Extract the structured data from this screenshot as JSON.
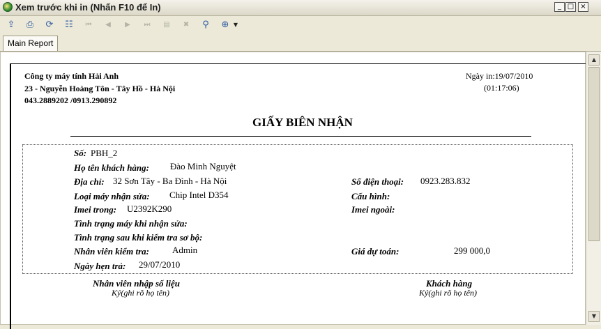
{
  "window": {
    "title": "Xem trước khi in (Nhấn F10 để In)",
    "buttons": {
      "minimize": "_",
      "maximize": "□",
      "close": "×"
    }
  },
  "toolbar": {
    "icons": [
      "export-icon",
      "print-icon",
      "refresh-icon",
      "group-tree-icon",
      "first-page-icon",
      "prev-page-icon",
      "next-page-icon",
      "last-page-icon",
      "goto-page-icon",
      "stop-icon",
      "search-icon",
      "zoom-icon"
    ]
  },
  "tabs": [
    {
      "label": "Main Report"
    }
  ],
  "company": {
    "name": "Công ty máy tính Hải Anh",
    "address": "23 - Nguyễn Hoàng Tôn - Tây Hồ - Hà Nội",
    "phones": "043.2889202 /0913.290892"
  },
  "report_date": {
    "label": "Ngày in:",
    "date": "19/07/2010",
    "time": "(01:17:06)"
  },
  "doc_title": "GIẤY BIÊN NHẬN",
  "fields": {
    "so": {
      "label": "Số:",
      "value": "PBH_2"
    },
    "ho_ten": {
      "label": "Họ tên khách hàng:",
      "value": "Đào Minh Nguyệt"
    },
    "dia_chi": {
      "label": "Địa chỉ:",
      "value": "32 Sơn Tây - Ba Đình - Hà Nội"
    },
    "so_dien_thoai": {
      "label": "Số điện thoại:",
      "value": "0923.283.832"
    },
    "loai_may": {
      "label": "Loại máy nhận sửa:",
      "value": "Chip Intel D354"
    },
    "cau_hinh": {
      "label": "Cấu hình:",
      "value": ""
    },
    "imei_trong": {
      "label": "Imei trong:",
      "value": "U2392K290"
    },
    "imei_ngoai": {
      "label": "Imei ngoài:",
      "value": ""
    },
    "tinh_trang_nhan": {
      "label": "Tình trạng máy khi nhận sửa:",
      "value": ""
    },
    "tinh_trang_kiem_tra": {
      "label": "Tình trạng sau khi kiểm tra sơ bộ:",
      "value": ""
    },
    "nhan_vien_kiem_tra": {
      "label": "Nhân viên kiểm tra:",
      "value": "Admin"
    },
    "gia_du_toan": {
      "label": "Giá dự toán:",
      "value": "299 000,0"
    },
    "ngay_hen_tra": {
      "label": "Ngày hẹn trả:",
      "value": "29/07/2010"
    }
  },
  "signatures": {
    "left": {
      "label": "Nhân viên nhập số liệu",
      "note": "Ký(ghi rõ họ tên)"
    },
    "right": {
      "label": "Khách hàng",
      "note": "Ký(ghi rõ họ tên)"
    }
  }
}
